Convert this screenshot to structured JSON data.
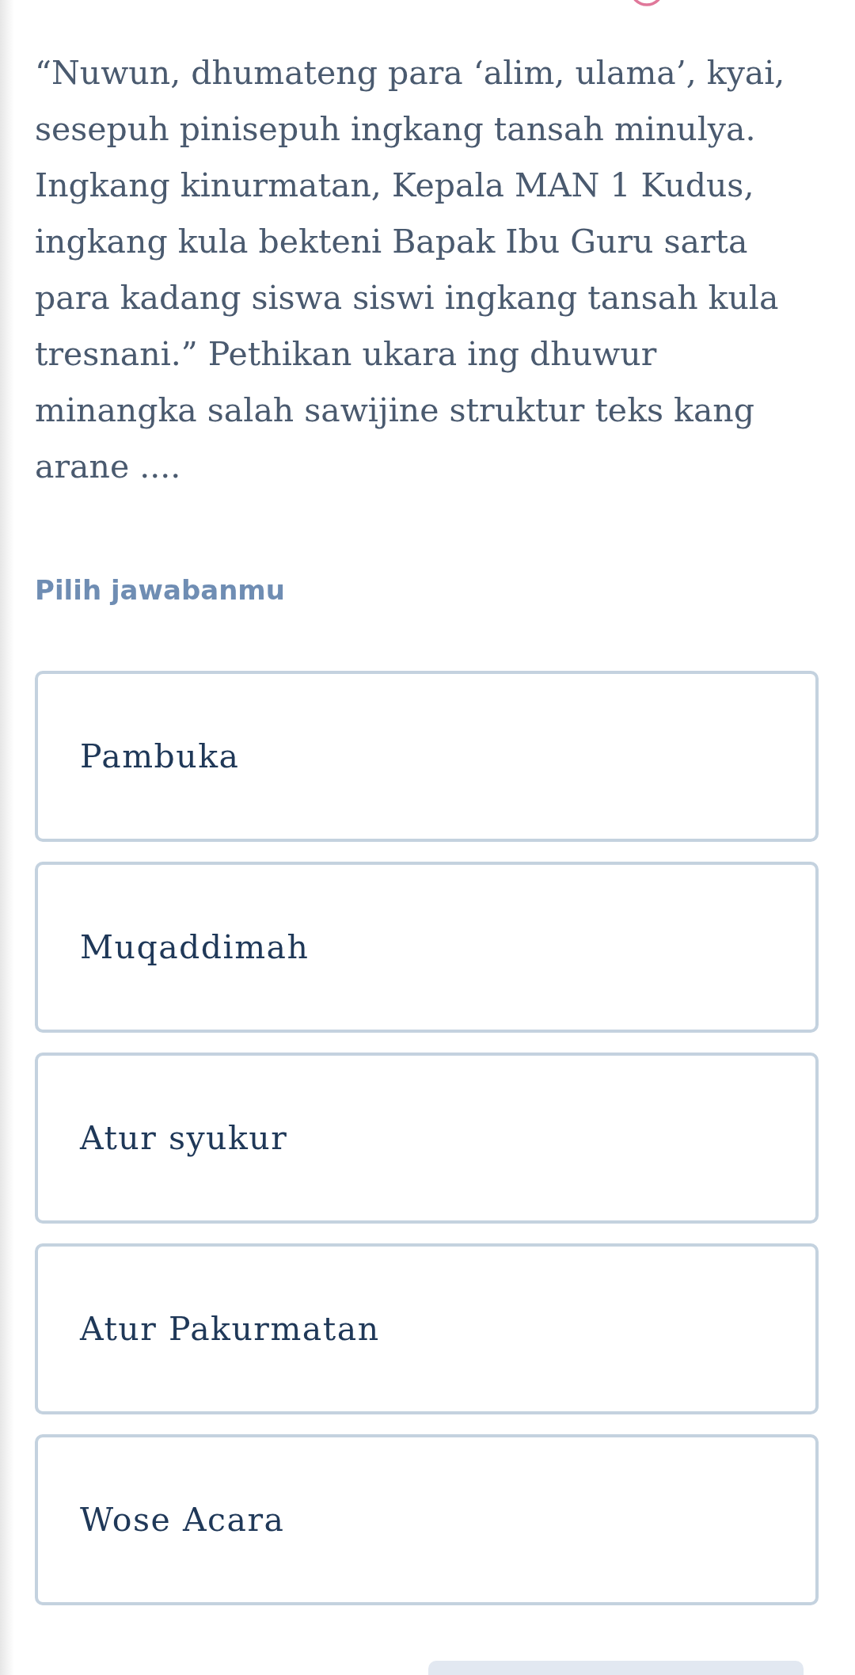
{
  "question": {
    "text": "“Nuwun, dhumateng para ‘alim, ulama’, kyai, sesepuh pinisepuh ingkang tansah minulya. Ingkang kinurmatan, Kepala MAN 1 Kudus, ingkang kula bekteni Bapak Ibu Guru sarta para kadang siswa siswi ingkang tansah kula tresnani.” Pethikan ukara ing dhuwur minangka salah sawijine struktur teks kang arane ...."
  },
  "answer_prompt": "Pilih jawabanmu",
  "options": [
    {
      "label": "Pambuka",
      "selected": false
    },
    {
      "label": "Muqaddimah",
      "selected": false
    },
    {
      "label": "Atur syukur",
      "selected": false
    },
    {
      "label": "Atur Pakurmatan",
      "selected": false
    },
    {
      "label": "Wose Acara",
      "selected": false
    }
  ]
}
